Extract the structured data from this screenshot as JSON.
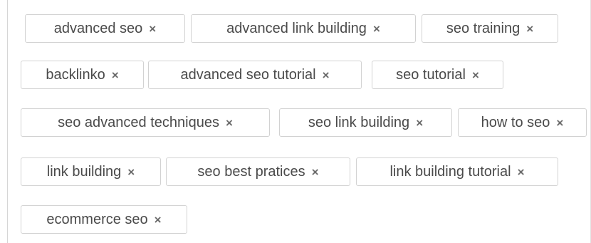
{
  "tags": [
    {
      "label": "advanced seo",
      "remove_icon": "×"
    },
    {
      "label": "advanced link building",
      "remove_icon": "×"
    },
    {
      "label": "seo training",
      "remove_icon": "×"
    },
    {
      "label": "backlinko",
      "remove_icon": "×"
    },
    {
      "label": "advanced seo tutorial",
      "remove_icon": "×"
    },
    {
      "label": "seo tutorial",
      "remove_icon": "×"
    },
    {
      "label": "seo advanced techniques",
      "remove_icon": "×"
    },
    {
      "label": "seo link building",
      "remove_icon": "×"
    },
    {
      "label": "how to seo",
      "remove_icon": "×"
    },
    {
      "label": "link building",
      "remove_icon": "×"
    },
    {
      "label": "seo best pratices",
      "remove_icon": "×"
    },
    {
      "label": "link building tutorial",
      "remove_icon": "×"
    },
    {
      "label": "ecommerce seo",
      "remove_icon": "×"
    }
  ],
  "colors": {
    "tag_border": "#d2d2d2",
    "tag_text": "#4a4a4a",
    "remove_icon": "#6a6a6a"
  }
}
